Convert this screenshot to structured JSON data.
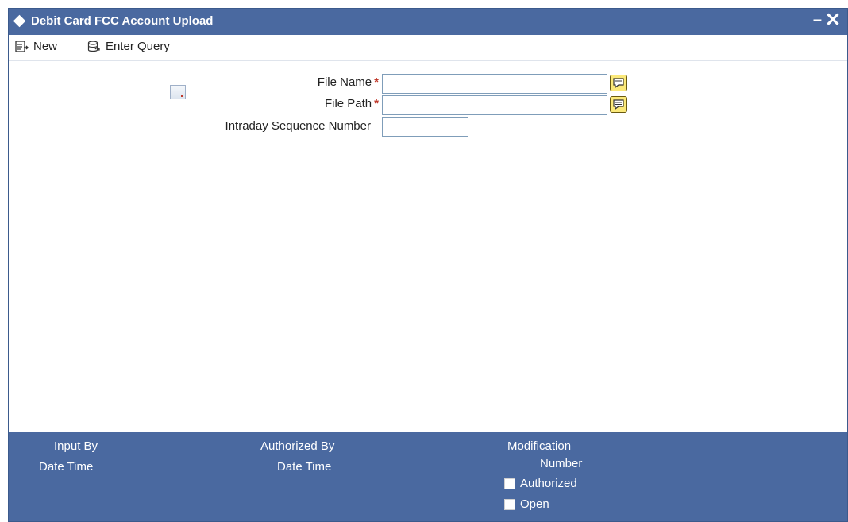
{
  "window": {
    "title": "Debit Card FCC Account Upload",
    "minimize_label": "–",
    "close_label": "✕"
  },
  "toolbar": {
    "new_label": "New",
    "enter_query_label": "Enter Query"
  },
  "form": {
    "file_name_label": "File Name",
    "file_path_label": "File Path",
    "intraday_seq_label": "Intraday Sequence Number",
    "required_marker": "*",
    "file_name_value": "",
    "file_path_value": "",
    "intraday_seq_value": ""
  },
  "footer": {
    "input_by": "Input By",
    "date_time_1": "Date Time",
    "authorized_by": "Authorized By",
    "date_time_2": "Date Time",
    "modification": "Modification",
    "number": "Number",
    "authorized_label": "Authorized",
    "open_label": "Open"
  },
  "colors": {
    "titlebar": "#4a69a0",
    "footer": "#4a69a0",
    "required": "#c0392b",
    "lov_button": "#fbe97a"
  }
}
